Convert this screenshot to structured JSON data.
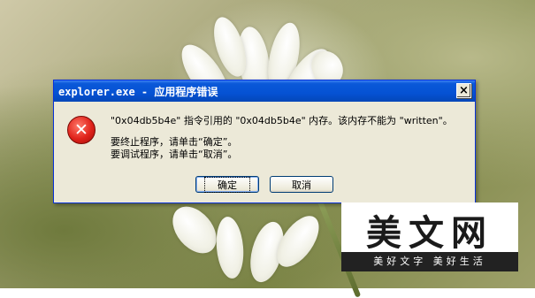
{
  "dialog": {
    "title": "explorer.exe - 应用程序错误",
    "close_label": "×",
    "message_line1": "\"0x04db5b4e\" 指令引用的 \"0x04db5b4e\" 内存。该内存不能为 \"written\"。",
    "message_line2": "要终止程序，请单击“确定”。",
    "message_line3": "要调试程序，请单击“取消”。",
    "ok_label": "确定",
    "cancel_label": "取消",
    "icon": "error-icon",
    "icon_glyph": "✕"
  },
  "watermark": {
    "logo": "美文网",
    "slogan": "美好文字 美好生活"
  },
  "colors": {
    "titlebar": "#0552d4",
    "dialog_bg": "#ece9d8",
    "error_red": "#e0231b"
  }
}
